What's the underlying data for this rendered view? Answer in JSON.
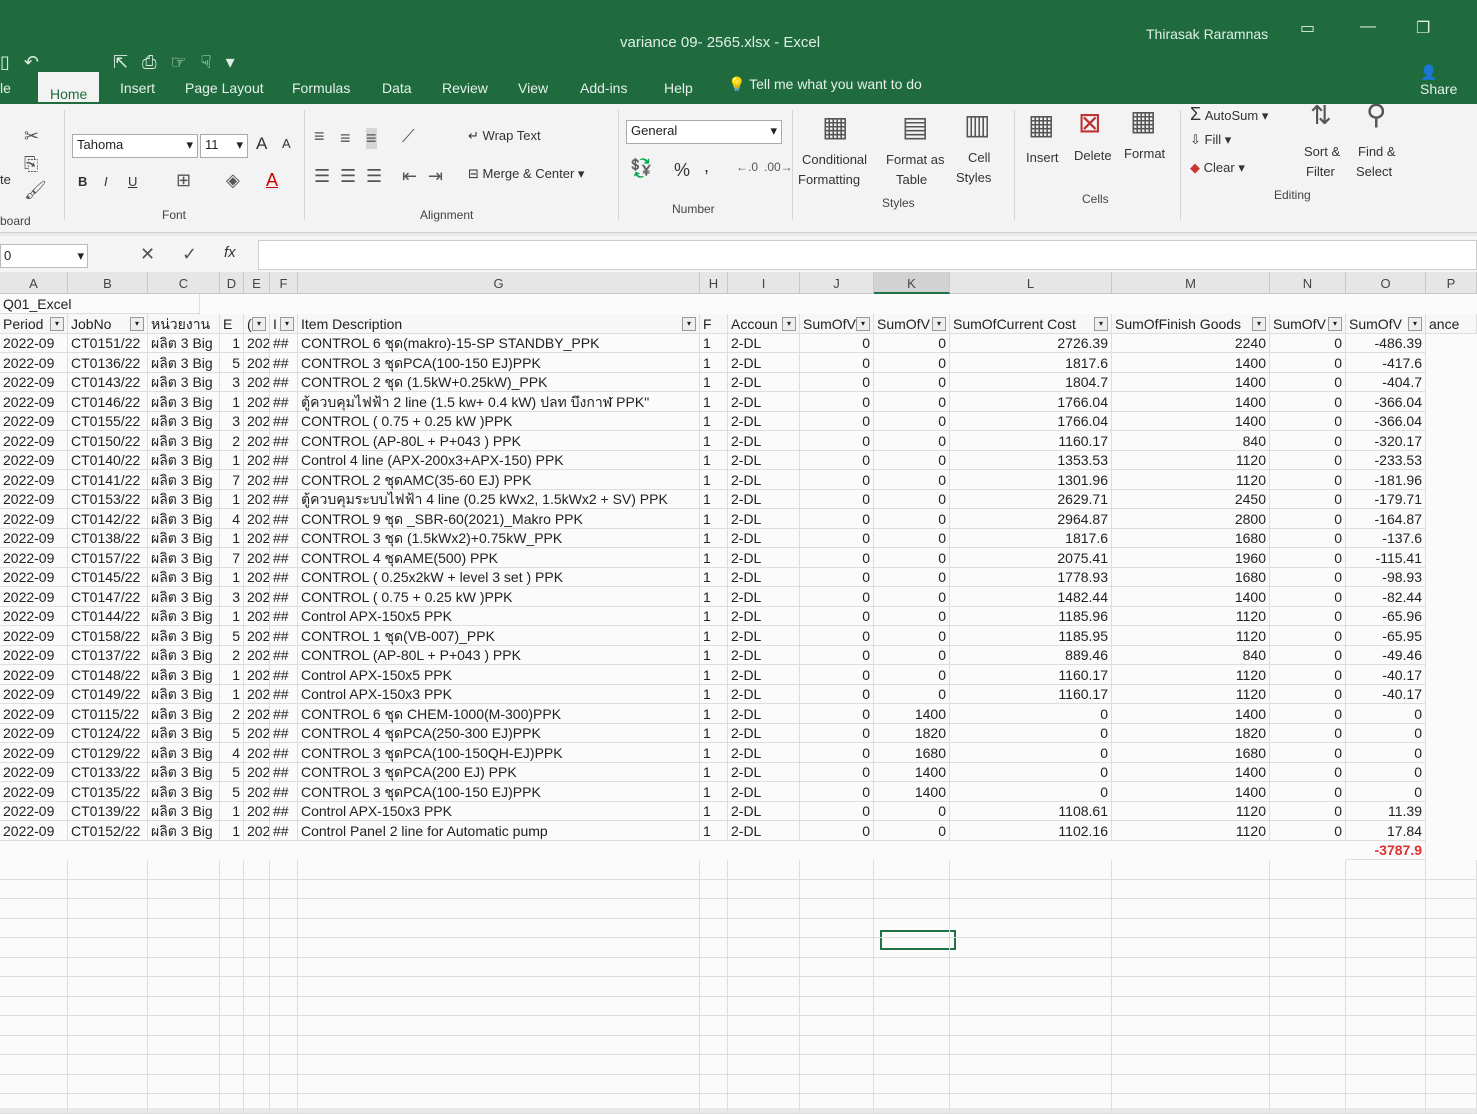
{
  "window": {
    "title": "variance 09- 2565.xlsx  -  Excel",
    "user": "Thirasak Raramnas",
    "share": "Share"
  },
  "tabs": [
    "le",
    "Home",
    "Insert",
    "Page Layout",
    "Formulas",
    "Data",
    "Review",
    "View",
    "Add-ins",
    "Help"
  ],
  "tell_me": "Tell me what you want to do",
  "ribbon": {
    "clipboard": {
      "label": "board",
      "paste_partial": "te"
    },
    "font": {
      "name": "Tahoma",
      "size": "11",
      "bold": "B",
      "italic": "I",
      "underline": "U",
      "label": "Font",
      "grow": "A",
      "shrink": "A",
      "color": "A"
    },
    "alignment": {
      "wrap": "Wrap Text",
      "merge": "Merge & Center",
      "label": "Alignment"
    },
    "number": {
      "format": "General",
      "percent": "%",
      "comma": ",",
      "label": "Number"
    },
    "styles": {
      "conditional": "Conditional",
      "conditional2": "Formatting",
      "format_as": "Format as",
      "format_as2": "Table",
      "cell": "Cell",
      "cell2": "Styles",
      "label": "Styles"
    },
    "cells": {
      "insert": "Insert",
      "delete": "Delete",
      "format": "Format",
      "label": "Cells"
    },
    "editing": {
      "autosum": "AutoSum",
      "fill": "Fill",
      "clear": "Clear",
      "sort": "Sort &",
      "sort2": "Filter",
      "find": "Find &",
      "find2": "Select",
      "label": "Editing"
    }
  },
  "formula_bar": {
    "name_box": "0",
    "fx": "fx",
    "value": ""
  },
  "columns": [
    "A",
    "B",
    "C",
    "D",
    "E",
    "F",
    "G",
    "H",
    "I",
    "J",
    "K",
    "L",
    "M",
    "N",
    "O",
    "P"
  ],
  "sheet": {
    "title_cell": "Q01_Excel",
    "headers": [
      "Period",
      "JobNo",
      "หน่วยงาน",
      "E",
      "(",
      "I",
      "Item Description",
      "F",
      "Accoun",
      "SumOfV",
      "SumOfV",
      "SumOfCurrent Cost",
      "SumOfFinish Goods",
      "SumOfV",
      "SumOfV",
      "ance"
    ],
    "rows": [
      [
        "2022-09",
        "CT0151/22",
        "ผลิต 3 Big",
        "1",
        "202",
        "##",
        "CONTROL 6 ชุด(makro)-15-SP STANDBY_PPK",
        "1",
        "2-DL",
        "0",
        "0",
        "2726.39",
        "2240",
        "0",
        "-486.39"
      ],
      [
        "2022-09",
        "CT0136/22",
        "ผลิต 3 Big",
        "5",
        "202",
        "##",
        "CONTROL 3 ชุดPCA(100-150 EJ)PPK",
        "1",
        "2-DL",
        "0",
        "0",
        "1817.6",
        "1400",
        "0",
        "-417.6"
      ],
      [
        "2022-09",
        "CT0143/22",
        "ผลิต 3 Big",
        "3",
        "202",
        "##",
        "CONTROL 2 ชุด (1.5kW+0.25kW)_PPK",
        "1",
        "2-DL",
        "0",
        "0",
        "1804.7",
        "1400",
        "0",
        "-404.7"
      ],
      [
        "2022-09",
        "CT0146/22",
        "ผลิต 3 Big",
        "1",
        "202",
        "##",
        "ตู้ควบคุมไฟฟ้า 2 line (1.5 kw+ 0.4 kW) ปลท บึงกาฬ PPK\"",
        "1",
        "2-DL",
        "0",
        "0",
        "1766.04",
        "1400",
        "0",
        "-366.04"
      ],
      [
        "2022-09",
        "CT0155/22",
        "ผลิต 3 Big",
        "3",
        "202",
        "##",
        "CONTROL ( 0.75 + 0.25 kW )PPK",
        "1",
        "2-DL",
        "0",
        "0",
        "1766.04",
        "1400",
        "0",
        "-366.04"
      ],
      [
        "2022-09",
        "CT0150/22",
        "ผลิต 3 Big",
        "2",
        "202",
        "##",
        "CONTROL (AP-80L + P+043 ) PPK",
        "1",
        "2-DL",
        "0",
        "0",
        "1160.17",
        "840",
        "0",
        "-320.17"
      ],
      [
        "2022-09",
        "CT0140/22",
        "ผลิต 3 Big",
        "1",
        "202",
        "##",
        "Control 4 line (APX-200x3+APX-150) PPK",
        "1",
        "2-DL",
        "0",
        "0",
        "1353.53",
        "1120",
        "0",
        "-233.53"
      ],
      [
        "2022-09",
        "CT0141/22",
        "ผลิต 3 Big",
        "7",
        "202",
        "##",
        "CONTROL 2 ชุดAMC(35-60 EJ) PPK",
        "1",
        "2-DL",
        "0",
        "0",
        "1301.96",
        "1120",
        "0",
        "-181.96"
      ],
      [
        "2022-09",
        "CT0153/22",
        "ผลิต 3 Big",
        "1",
        "202",
        "##",
        "ตู้ควบคุมระบบไฟฟ้า 4 line (0.25 kWx2, 1.5kWx2 + SV) PPK",
        "1",
        "2-DL",
        "0",
        "0",
        "2629.71",
        "2450",
        "0",
        "-179.71"
      ],
      [
        "2022-09",
        "CT0142/22",
        "ผลิต 3 Big",
        "4",
        "202",
        "##",
        "CONTROL 9 ชุด _SBR-60(2021)_Makro PPK",
        "1",
        "2-DL",
        "0",
        "0",
        "2964.87",
        "2800",
        "0",
        "-164.87"
      ],
      [
        "2022-09",
        "CT0138/22",
        "ผลิต 3 Big",
        "1",
        "202",
        "##",
        "CONTROL 3 ชุด (1.5kWx2)+0.75kW_PPK",
        "1",
        "2-DL",
        "0",
        "0",
        "1817.6",
        "1680",
        "0",
        "-137.6"
      ],
      [
        "2022-09",
        "CT0157/22",
        "ผลิต 3 Big",
        "7",
        "202",
        "##",
        "CONTROL 4 ชุดAME(500) PPK",
        "1",
        "2-DL",
        "0",
        "0",
        "2075.41",
        "1960",
        "0",
        "-115.41"
      ],
      [
        "2022-09",
        "CT0145/22",
        "ผลิต 3 Big",
        "1",
        "202",
        "##",
        "CONTROL ( 0.25x2kW + level 3 set ) PPK",
        "1",
        "2-DL",
        "0",
        "0",
        "1778.93",
        "1680",
        "0",
        "-98.93"
      ],
      [
        "2022-09",
        "CT0147/22",
        "ผลิต 3 Big",
        "3",
        "202",
        "##",
        "CONTROL ( 0.75 + 0.25 kW )PPK",
        "1",
        "2-DL",
        "0",
        "0",
        "1482.44",
        "1400",
        "0",
        "-82.44"
      ],
      [
        "2022-09",
        "CT0144/22",
        "ผลิต 3 Big",
        "1",
        "202",
        "##",
        "Control APX-150x5 PPK",
        "1",
        "2-DL",
        "0",
        "0",
        "1185.96",
        "1120",
        "0",
        "-65.96"
      ],
      [
        "2022-09",
        "CT0158/22",
        "ผลิต 3 Big",
        "5",
        "202",
        "##",
        "CONTROL 1 ชุด(VB-007)_PPK",
        "1",
        "2-DL",
        "0",
        "0",
        "1185.95",
        "1120",
        "0",
        "-65.95"
      ],
      [
        "2022-09",
        "CT0137/22",
        "ผลิต 3 Big",
        "2",
        "202",
        "##",
        "CONTROL (AP-80L + P+043 ) PPK",
        "1",
        "2-DL",
        "0",
        "0",
        "889.46",
        "840",
        "0",
        "-49.46"
      ],
      [
        "2022-09",
        "CT0148/22",
        "ผลิต 3 Big",
        "1",
        "202",
        "##",
        "Control APX-150x5 PPK",
        "1",
        "2-DL",
        "0",
        "0",
        "1160.17",
        "1120",
        "0",
        "-40.17"
      ],
      [
        "2022-09",
        "CT0149/22",
        "ผลิต 3 Big",
        "1",
        "202",
        "##",
        "Control APX-150x3 PPK",
        "1",
        "2-DL",
        "0",
        "0",
        "1160.17",
        "1120",
        "0",
        "-40.17"
      ],
      [
        "2022-09",
        "CT0115/22",
        "ผลิต 3 Big",
        "2",
        "202",
        "##",
        "CONTROL 6 ชุด CHEM-1000(M-300)PPK",
        "1",
        "2-DL",
        "0",
        "1400",
        "0",
        "1400",
        "0",
        "0"
      ],
      [
        "2022-09",
        "CT0124/22",
        "ผลิต 3 Big",
        "5",
        "202",
        "##",
        "CONTROL 4 ชุดPCA(250-300 EJ)PPK",
        "1",
        "2-DL",
        "0",
        "1820",
        "0",
        "1820",
        "0",
        "0"
      ],
      [
        "2022-09",
        "CT0129/22",
        "ผลิต 3 Big",
        "4",
        "202",
        "##",
        "CONTROL 3 ชุดPCA(100-150QH-EJ)PPK",
        "1",
        "2-DL",
        "0",
        "1680",
        "0",
        "1680",
        "0",
        "0"
      ],
      [
        "2022-09",
        "CT0133/22",
        "ผลิต 3 Big",
        "5",
        "202",
        "##",
        "CONTROL 3 ชุดPCA(200 EJ) PPK",
        "1",
        "2-DL",
        "0",
        "1400",
        "0",
        "1400",
        "0",
        "0"
      ],
      [
        "2022-09",
        "CT0135/22",
        "ผลิต 3 Big",
        "5",
        "202",
        "##",
        "CONTROL 3 ชุดPCA(100-150 EJ)PPK",
        "1",
        "2-DL",
        "0",
        "1400",
        "0",
        "1400",
        "0",
        "0"
      ],
      [
        "2022-09",
        "CT0139/22",
        "ผลิต 3 Big",
        "1",
        "202",
        "##",
        "Control APX-150x3 PPK",
        "1",
        "2-DL",
        "0",
        "0",
        "1108.61",
        "1120",
        "0",
        "11.39"
      ],
      [
        "2022-09",
        "CT0152/22",
        "ผลิต 3 Big",
        "1",
        "202",
        "##",
        "Control Panel 2 line for Automatic pump",
        "1",
        "2-DL",
        "0",
        "0",
        "1102.16",
        "1120",
        "0",
        "17.84"
      ]
    ],
    "total": "-3787.9",
    "accent": "#217346",
    "total_color": "#e03030"
  }
}
